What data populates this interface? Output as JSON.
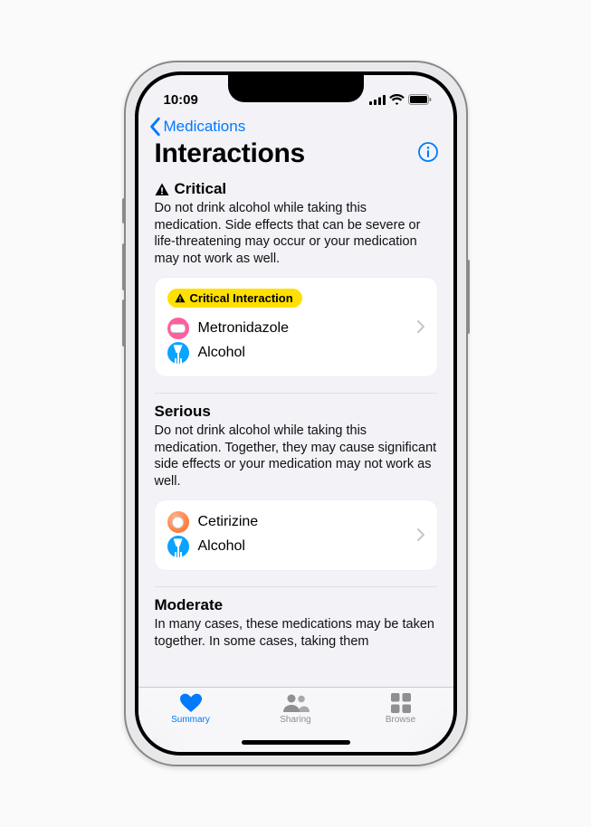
{
  "status": {
    "time": "10:09"
  },
  "nav": {
    "back_label": "Medications"
  },
  "header": {
    "title": "Interactions"
  },
  "sections": {
    "critical": {
      "title": "Critical",
      "desc": "Do not drink alcohol while taking this medication. Side effects that can be severe or life-threatening may occur or your medication may not work as well.",
      "badge": "Critical Interaction",
      "drug1": "Metronidazole",
      "drug2": "Alcohol"
    },
    "serious": {
      "title": "Serious",
      "desc": "Do not drink alcohol while taking this medication. Together, they may cause significant side effects or your medication may not work as well.",
      "drug1": "Cetirizine",
      "drug2": "Alcohol"
    },
    "moderate": {
      "title": "Moderate",
      "desc": "In many cases, these medications may be taken together. In some cases, taking them"
    }
  },
  "tabs": {
    "summary": "Summary",
    "sharing": "Sharing",
    "browse": "Browse"
  }
}
